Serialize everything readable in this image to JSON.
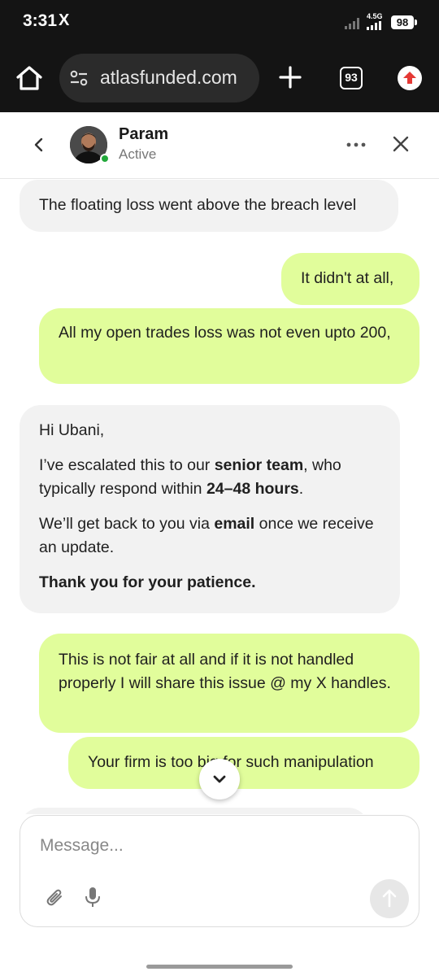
{
  "status_bar": {
    "time": "3:31",
    "x_logo": "X",
    "network_label": "4.5G",
    "battery": "98"
  },
  "browser": {
    "url": "atlasfunded.com",
    "tab_count": "93",
    "icons": [
      "home-icon",
      "site-settings-icon",
      "plus-icon",
      "tab-switcher-icon",
      "update-arrow-icon"
    ]
  },
  "chat_header": {
    "agent_name": "Param",
    "agent_status": "Active",
    "presence_color": "#22a83a"
  },
  "messages": [
    {
      "sender": "agent",
      "text": "The floating loss went above the breach level"
    },
    {
      "sender": "user",
      "text": "It didn't at all,"
    },
    {
      "sender": "user",
      "text": "All my open trades loss was not even upto 200,"
    },
    {
      "sender": "agent",
      "greeting": "Hi Ubani,",
      "p2_a": "I’ve escalated this to our ",
      "p2_b": "senior team",
      "p2_c": ", who typically respond within ",
      "p2_d": "24–48 hours",
      "p2_e": ".",
      "p3_a": "We’ll get back to you via ",
      "p3_b": "email",
      "p3_c": " once we receive an update.",
      "p4": "Thank you for your patience."
    },
    {
      "sender": "user",
      "text": "This is not fair at all and if it is not handled properly I will share this issue @ my X handles."
    },
    {
      "sender": "user",
      "text": "Your firm is too big for such manipulation"
    }
  ],
  "composer": {
    "placeholder": "Message..."
  },
  "colors": {
    "user_bubble": "#e1fd9b",
    "agent_bubble": "#f2f2f2",
    "browser_bar": "#141414"
  }
}
